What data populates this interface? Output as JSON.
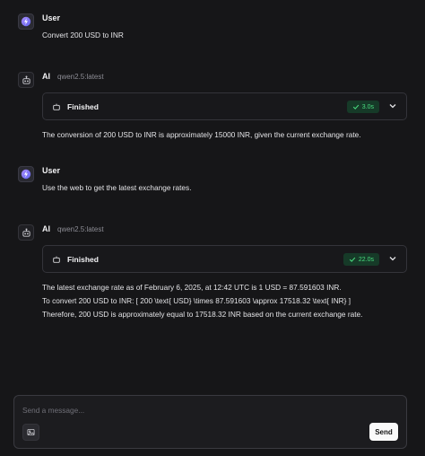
{
  "messages": [
    {
      "role": "User",
      "text": "Convert 200 USD to INR"
    },
    {
      "role": "AI",
      "model": "qwen2.5:latest",
      "status": "Finished",
      "duration": "3.0s",
      "lines": [
        "The conversion of 200 USD to INR is approximately 15000 INR, given the current exchange rate."
      ]
    },
    {
      "role": "User",
      "text": "Use the web to get the latest exchange rates."
    },
    {
      "role": "AI",
      "model": "qwen2.5:latest",
      "status": "Finished",
      "duration": "22.0s",
      "lines": [
        "The latest exchange rate as of February 6, 2025, at 12:42 UTC is 1 USD = 87.591603 INR.",
        "To convert 200 USD to INR: [ 200 \\text{ USD} \\times 87.591603 \\approx 17518.32 \\text{ INR} ]",
        "Therefore, 200 USD is approximately equal to 17518.32 INR based on the current exchange rate."
      ]
    }
  ],
  "composer": {
    "placeholder": "Send a message...",
    "value": "",
    "send_label": "Send"
  },
  "colors": {
    "background": "#161618",
    "success_badge_bg": "#163a28",
    "success_badge_text": "#4ade80",
    "send_button": "#fafafa"
  },
  "icons": {
    "user_avatar": "sparkle-logo-icon",
    "ai_avatar": "robot-icon",
    "status": "robot-icon",
    "badge": "check-icon",
    "expand": "chevron-down-icon",
    "attach": "image-icon"
  }
}
